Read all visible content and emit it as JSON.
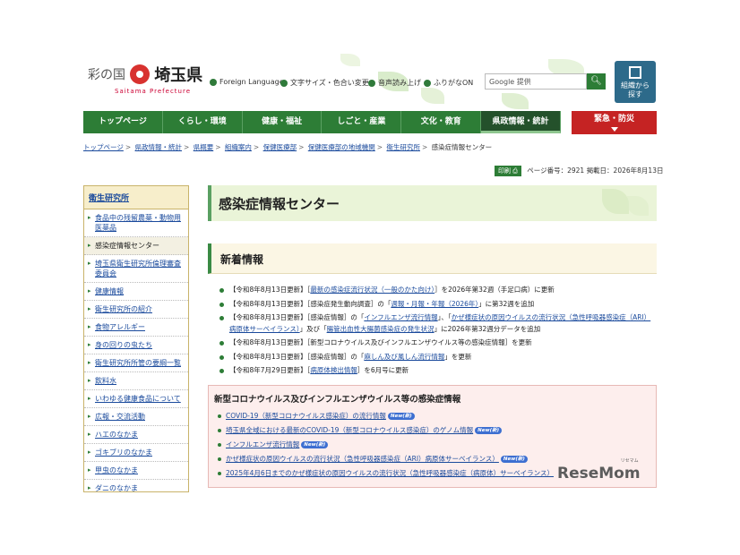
{
  "header": {
    "logo_prefix": "彩の国",
    "logo_main": "埼玉県",
    "logo_sub": "Saitama Prefecture",
    "links": [
      "Foreign Language",
      "文字サイズ・色合い変更",
      "音声読み上げ",
      "ふりがなON"
    ],
    "search_placeholder": "Google 提供",
    "org_button": [
      "組織から",
      "探す"
    ]
  },
  "nav": {
    "items": [
      "トップページ",
      "くらし・環境",
      "健康・福祉",
      "しごと・産業",
      "文化・教育",
      "県政情報・統計"
    ],
    "active_index": 5,
    "emergency": "緊急・防災"
  },
  "breadcrumb": [
    "トップページ",
    "県政情報・統計",
    "県概要",
    "組織案内",
    "保健医療部",
    "保健医療部の地域機関",
    "衛生研究所",
    "感染症情報センター"
  ],
  "meta": {
    "print_label": "印刷",
    "page_number": "ページ番号：2921",
    "posted": "掲載日：2026年8月13日"
  },
  "sidebar": {
    "title": "衛生研究所",
    "items": [
      "食品中の残留農薬・動物用医薬品",
      "感染症情報センター",
      "埼玉県衛生研究所倫理審査委員会",
      "健康情報",
      "衛生研究所の紹介",
      "食物アレルギー",
      "身の回りの虫たち",
      "衛生研究所所管の要綱一覧",
      "飲料水",
      "いわゆる健康食品について",
      "広報・交流活動",
      "ハエのなかま",
      "ゴキブリのなかま",
      "甲虫のなかま",
      "ダニのなかま"
    ],
    "current_index": 1
  },
  "main": {
    "title": "感染症情報センター",
    "news_heading": "新着情報",
    "news": [
      {
        "date": "【令和8年8月13日更新】",
        "link": "最新の感染症流行状況（一般のかた向け）",
        "rest": "を2026年第32週（手足口病）に更新"
      },
      {
        "date": "【令和8年8月13日更新】",
        "pre": "［感染症発生動向調査］の「",
        "link": "週報・月報・年報（2026年）",
        "rest": "」に第32週を追加"
      },
      {
        "date": "【令和8年8月13日更新】",
        "pre": "［感染症情報］の「",
        "link": "インフルエンザ流行情報",
        "mid": "」、「",
        "link2": "かぜ様症状の原因ウイルスの流行状況（急性呼吸器感染症（ARI）病原体サーベイランス）",
        "mid2": "」及び「",
        "link3": "腸管出血性大腸菌感染症の発生状況",
        "rest": "」に2026年第32週分データを追加"
      },
      {
        "date": "【令和8年8月13日更新】",
        "rest": "［新型コロナウイルス及びインフルエンザウイルス等の感染症情報］を更新"
      },
      {
        "date": "【令和8年8月13日更新】",
        "pre": "［感染症情報］の「",
        "link": "麻しん及び風しん流行情報",
        "rest": "」を更新"
      },
      {
        "date": "【令和8年7月29日更新】",
        "pre": "［",
        "link": "病原体検出情報",
        "rest": "］を6月号に更新"
      }
    ],
    "covid_heading": "新型コロナウイルス及びインフルエンザウイルス等の感染症情報",
    "covid_items": [
      {
        "text": "COVID-19（新型コロナウイルス感染症）の流行情報",
        "badge": "New(新)"
      },
      {
        "text": "埼玉県全域における最新のCOVID-19（新型コロナウイルス感染症）のゲノム情報",
        "badge": "New(新)"
      },
      {
        "text": "インフルエンザ流行情報",
        "badge": "New(新)"
      },
      {
        "text": "かぜ様症状の原因ウイルスの流行状況（急性呼吸器感染症（ARI）病原体サーベイランス）",
        "badge": "New(新)"
      },
      {
        "text": "2025年4月6日までのかぜ様症状の原因ウイルスの流行状況（急性呼吸器感染症（病原体）サーベイランス）",
        "badge": ""
      }
    ]
  },
  "watermark": {
    "main": "ReseMom",
    "sub": "リセマム"
  }
}
